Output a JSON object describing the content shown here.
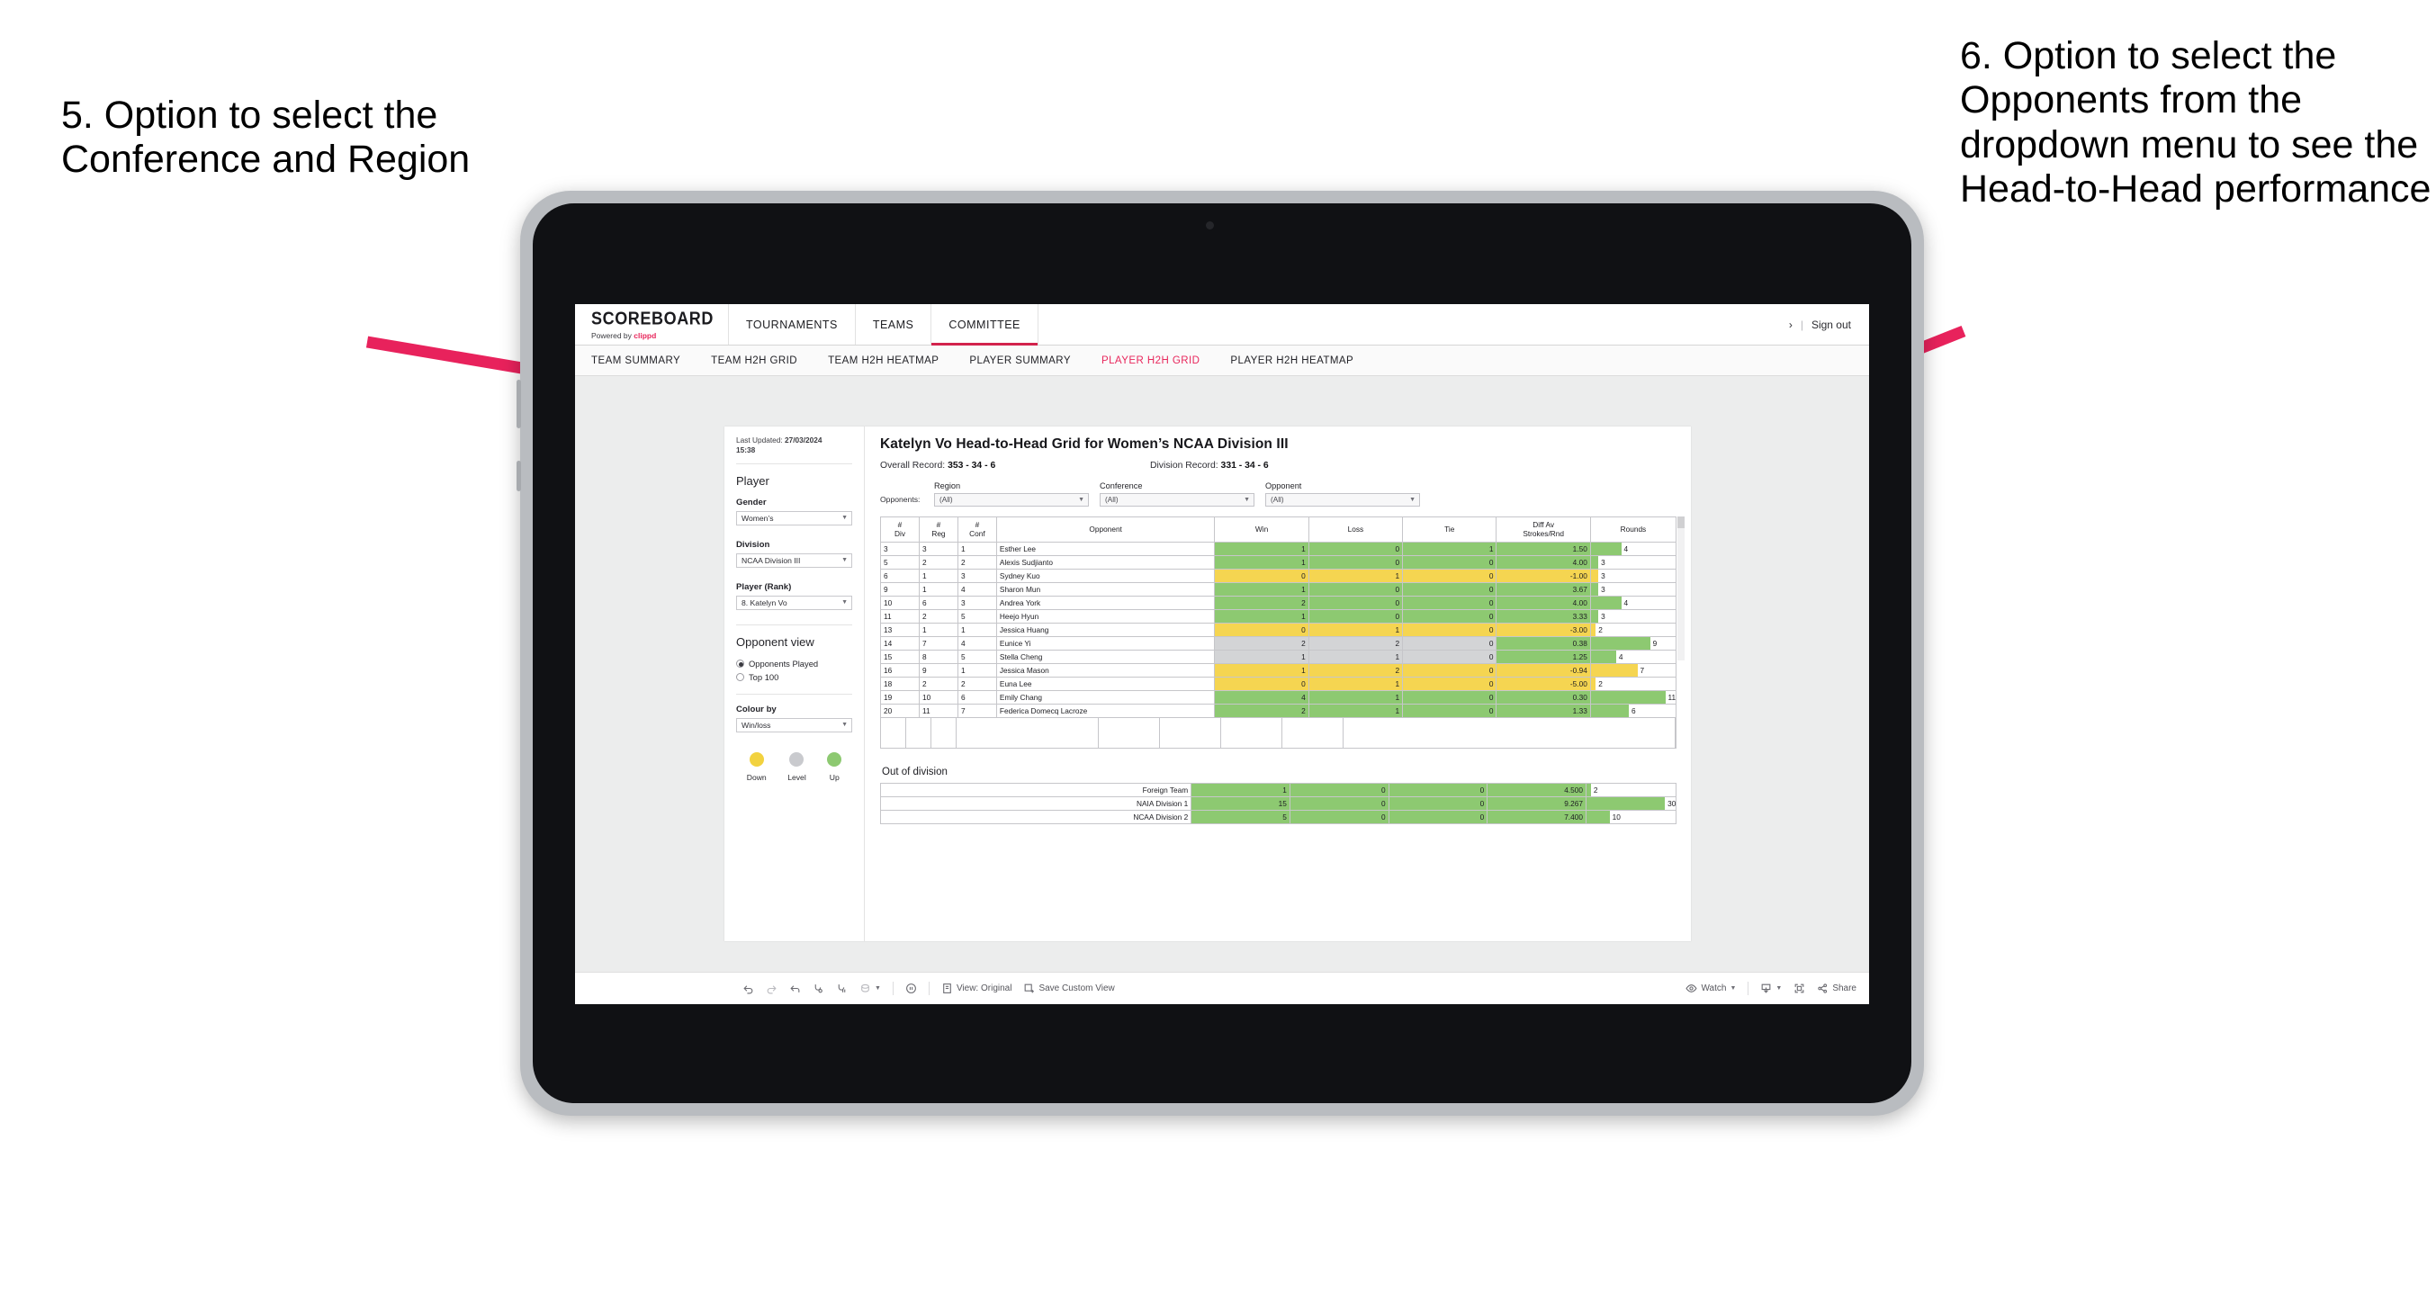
{
  "annotations": {
    "left": "5. Option to select the Conference and Region",
    "right": "6. Option to select the Opponents from the dropdown menu to see the Head-to-Head performance",
    "arrow_color": "#e8225c"
  },
  "app": {
    "brand": {
      "title": "SCOREBOARD",
      "powered_prefix": "Powered by ",
      "powered_brand": "clippd"
    },
    "top_nav": [
      {
        "label": "TOURNAMENTS",
        "active": false
      },
      {
        "label": "TEAMS",
        "active": false
      },
      {
        "label": "COMMITTEE",
        "active": true
      }
    ],
    "header_right": {
      "chevron": "›",
      "separator": "|",
      "sign_out": "Sign out"
    },
    "sub_nav": [
      {
        "label": "TEAM SUMMARY",
        "active": false
      },
      {
        "label": "TEAM H2H GRID",
        "active": false
      },
      {
        "label": "TEAM H2H HEATMAP",
        "active": false
      },
      {
        "label": "PLAYER SUMMARY",
        "active": false
      },
      {
        "label": "PLAYER H2H GRID",
        "active": true
      },
      {
        "label": "PLAYER H2H HEATMAP",
        "active": false
      }
    ]
  },
  "sidebar": {
    "last_updated_label": "Last Updated: ",
    "last_updated_value": "27/03/2024",
    "last_updated_time": "15:38",
    "section_player": "Player",
    "fields": [
      {
        "label": "Gender",
        "value": "Women’s"
      },
      {
        "label": "Division",
        "value": "NCAA Division III"
      },
      {
        "label": "Player (Rank)",
        "value": "8. Katelyn Vo"
      }
    ],
    "opponent_view": {
      "title": "Opponent view",
      "options": [
        {
          "label": "Opponents Played",
          "selected": true
        },
        {
          "label": "Top 100",
          "selected": false
        }
      ]
    },
    "colour_by": {
      "label": "Colour by",
      "value": "Win/loss"
    },
    "legend": [
      {
        "label": "Down",
        "color": "#f2d23f"
      },
      {
        "label": "Level",
        "color": "#c9cace"
      },
      {
        "label": "Up",
        "color": "#8dc971"
      }
    ]
  },
  "main": {
    "title": "Katelyn Vo Head-to-Head Grid for Women’s NCAA Division III",
    "overall_record_label": "Overall Record: ",
    "overall_record_value": "353 - 34 - 6",
    "division_record_label": "Division Record: ",
    "division_record_value": "331 - 34 - 6",
    "filters_label": "Opponents:",
    "filters": [
      {
        "label": "Region",
        "value": "(All)"
      },
      {
        "label": "Conference",
        "value": "(All)"
      },
      {
        "label": "Opponent",
        "value": "(All)"
      }
    ],
    "columns": [
      "# Div",
      "# Reg",
      "# Conf",
      "Opponent",
      "Win",
      "Loss",
      "Tie",
      "Diff Av Strokes/Rnd",
      "Rounds"
    ],
    "column_lines": [
      [
        "#",
        "Div"
      ],
      [
        "#",
        "Reg"
      ],
      [
        "#",
        "Conf"
      ],
      [
        "Opponent"
      ],
      [
        "Win"
      ],
      [
        "Loss"
      ],
      [
        "Tie"
      ],
      [
        "Diff Av",
        "Strokes/Rnd"
      ],
      [
        "Rounds"
      ]
    ],
    "rows": [
      {
        "div": "3",
        "reg": "3",
        "conf": "1",
        "opponent": "Esther Lee",
        "win": "1",
        "loss": "0",
        "tie": "1",
        "diff": "1.50",
        "rounds": "4",
        "color": "green",
        "bar_pct": 36
      },
      {
        "div": "5",
        "reg": "2",
        "conf": "2",
        "opponent": "Alexis Sudjianto",
        "win": "1",
        "loss": "0",
        "tie": "0",
        "diff": "4.00",
        "rounds": "3",
        "color": "green",
        "bar_pct": 9
      },
      {
        "div": "6",
        "reg": "1",
        "conf": "3",
        "opponent": "Sydney Kuo",
        "win": "0",
        "loss": "1",
        "tie": "0",
        "diff": "-1.00",
        "rounds": "3",
        "color": "yellow",
        "bar_pct": 9
      },
      {
        "div": "9",
        "reg": "1",
        "conf": "4",
        "opponent": "Sharon Mun",
        "win": "1",
        "loss": "0",
        "tie": "0",
        "diff": "3.67",
        "rounds": "3",
        "color": "green",
        "bar_pct": 9
      },
      {
        "div": "10",
        "reg": "6",
        "conf": "3",
        "opponent": "Andrea York",
        "win": "2",
        "loss": "0",
        "tie": "0",
        "diff": "4.00",
        "rounds": "4",
        "color": "green",
        "bar_pct": 36
      },
      {
        "div": "11",
        "reg": "2",
        "conf": "5",
        "opponent": "Heejo Hyun",
        "win": "1",
        "loss": "0",
        "tie": "0",
        "diff": "3.33",
        "rounds": "3",
        "color": "green",
        "bar_pct": 9
      },
      {
        "div": "13",
        "reg": "1",
        "conf": "1",
        "opponent": "Jessica Huang",
        "win": "0",
        "loss": "1",
        "tie": "0",
        "diff": "-3.00",
        "rounds": "2",
        "color": "yellow",
        "bar_pct": 6
      },
      {
        "div": "14",
        "reg": "7",
        "conf": "4",
        "opponent": "Eunice Yi",
        "win": "2",
        "loss": "2",
        "tie": "0",
        "diff": "0.38",
        "rounds": "9",
        "color": "grey",
        "bar_pct": 70,
        "diff_color": "green"
      },
      {
        "div": "15",
        "reg": "8",
        "conf": "5",
        "opponent": "Stella Cheng",
        "win": "1",
        "loss": "1",
        "tie": "0",
        "diff": "1.25",
        "rounds": "4",
        "color": "grey",
        "bar_pct": 30,
        "diff_color": "green"
      },
      {
        "div": "16",
        "reg": "9",
        "conf": "1",
        "opponent": "Jessica Mason",
        "win": "1",
        "loss": "2",
        "tie": "0",
        "diff": "-0.94",
        "rounds": "7",
        "color": "yellow",
        "bar_pct": 55
      },
      {
        "div": "18",
        "reg": "2",
        "conf": "2",
        "opponent": "Euna Lee",
        "win": "0",
        "loss": "1",
        "tie": "0",
        "diff": "-5.00",
        "rounds": "2",
        "color": "yellow",
        "bar_pct": 6
      },
      {
        "div": "19",
        "reg": "10",
        "conf": "6",
        "opponent": "Emily Chang",
        "win": "4",
        "loss": "1",
        "tie": "0",
        "diff": "0.30",
        "rounds": "11",
        "color": "green",
        "bar_pct": 88
      },
      {
        "div": "20",
        "reg": "11",
        "conf": "7",
        "opponent": "Federica Domecq Lacroze",
        "win": "2",
        "loss": "1",
        "tie": "0",
        "diff": "1.33",
        "rounds": "6",
        "color": "green",
        "bar_pct": 45
      }
    ],
    "out_of_division": {
      "title": "Out of division",
      "rows": [
        {
          "name": "Foreign Team",
          "win": "1",
          "loss": "0",
          "tie": "0",
          "diff": "4.500",
          "rounds": "2",
          "color": "green",
          "bar_pct": 5
        },
        {
          "name": "NAIA Division 1",
          "win": "15",
          "loss": "0",
          "tie": "0",
          "diff": "9.267",
          "rounds": "30",
          "color": "green",
          "bar_pct": 88
        },
        {
          "name": "NCAA Division 2",
          "win": "5",
          "loss": "0",
          "tie": "0",
          "diff": "7.400",
          "rounds": "10",
          "color": "green",
          "bar_pct": 26
        }
      ]
    }
  },
  "toolbar": {
    "view_label": "View: Original",
    "save_label": "Save Custom View",
    "watch_label": "Watch",
    "share_label": "Share"
  }
}
